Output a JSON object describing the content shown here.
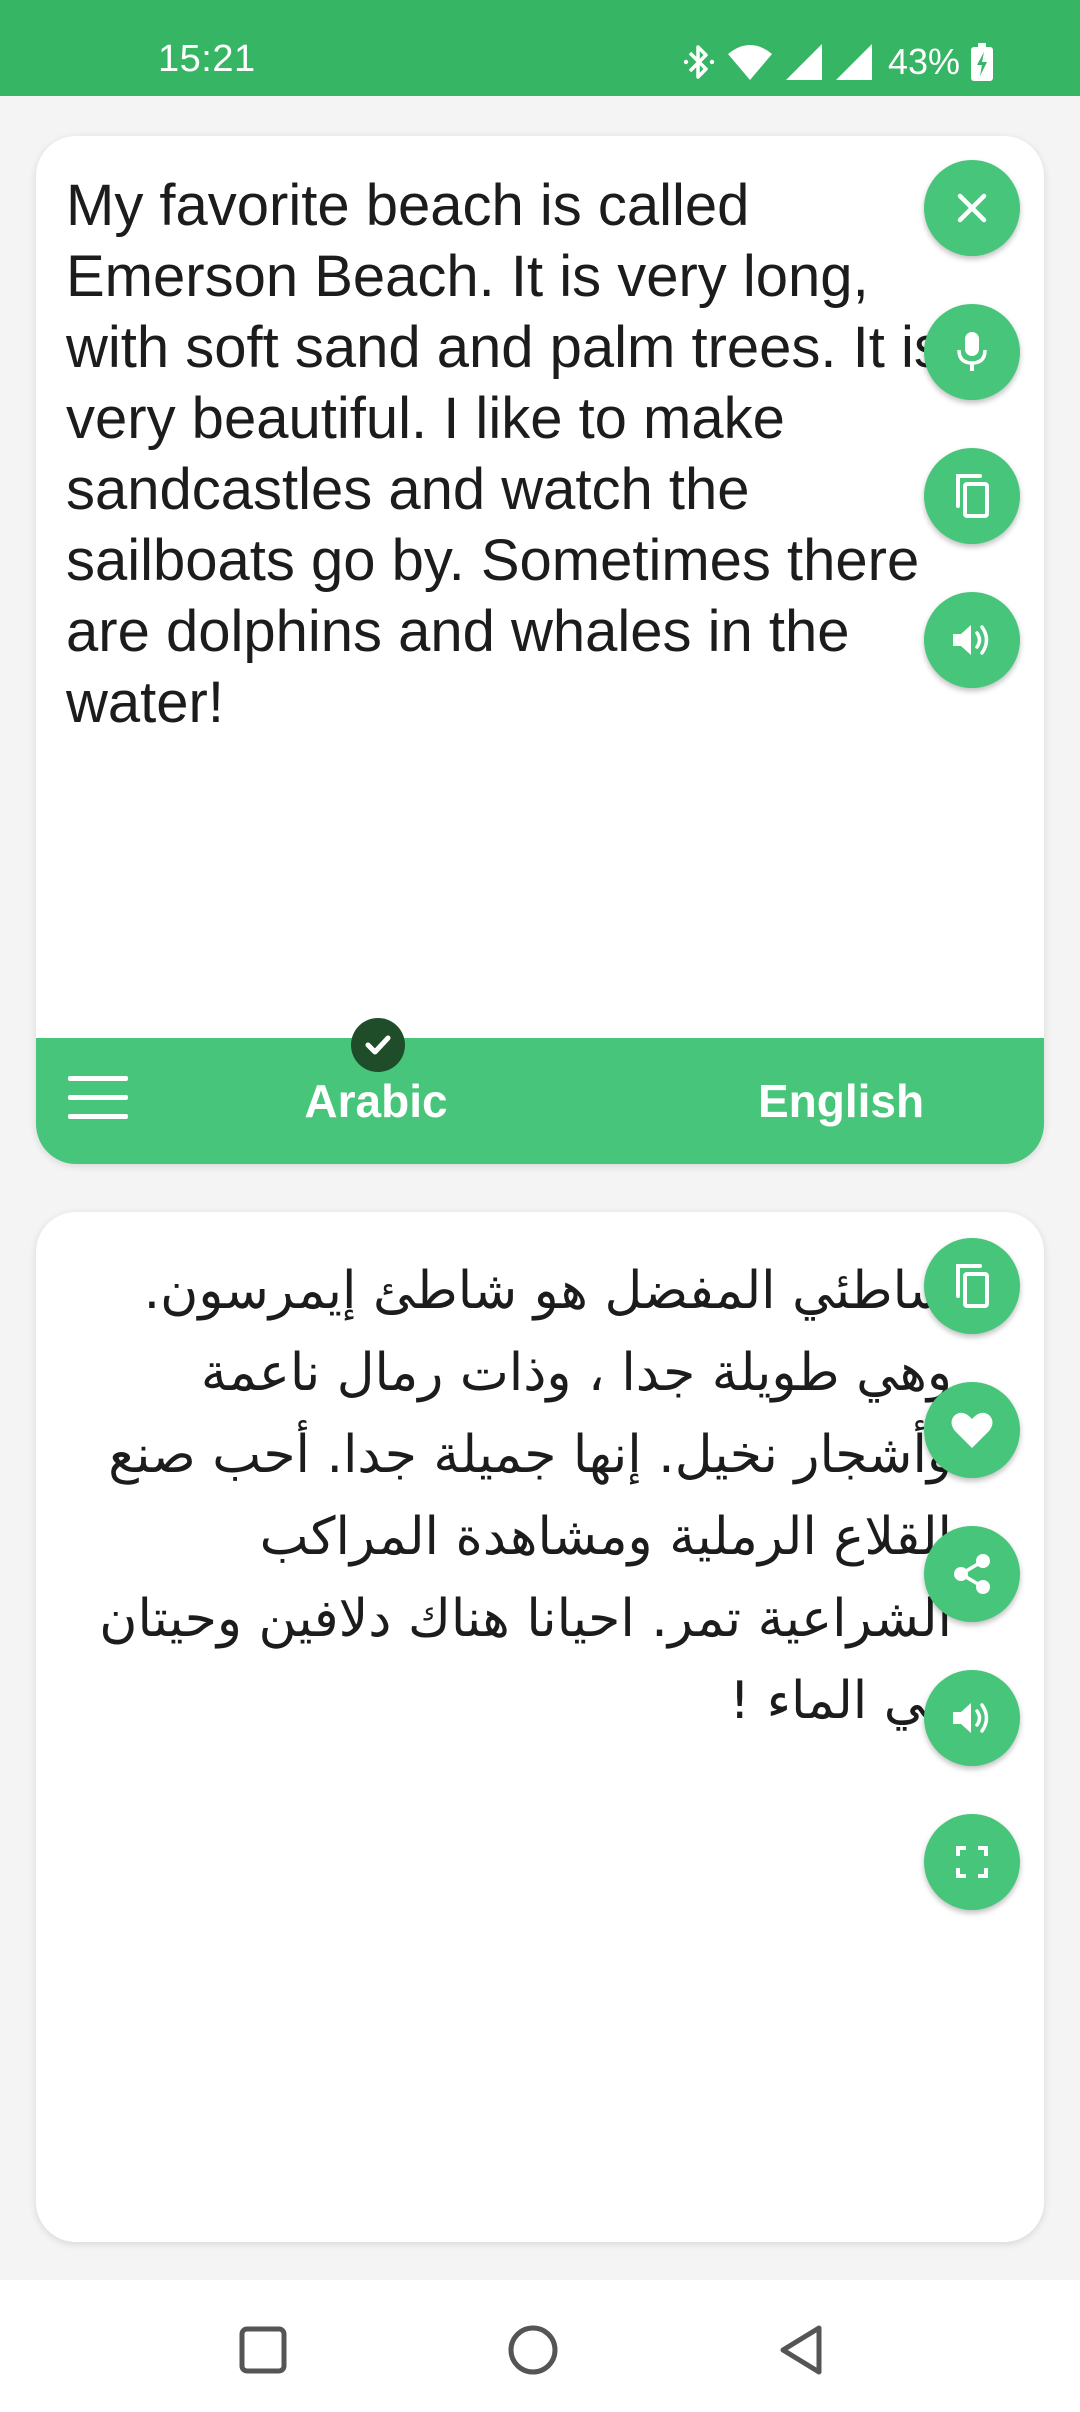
{
  "status_bar": {
    "time": "15:21",
    "battery": "43%",
    "icons": [
      "bluetooth-icon",
      "wifi-icon",
      "signal-icon",
      "signal-icon",
      "battery-charging-icon"
    ]
  },
  "source": {
    "text": "My favorite beach is called Emerson Beach. It is very long, with soft sand and palm trees. It is very beautiful. I like to make sandcastles and watch the sailboats go by. Sometimes there are dolphins and whales in the water!",
    "actions": [
      "close-icon",
      "microphone-icon",
      "copy-icon",
      "speaker-icon"
    ]
  },
  "language_bar": {
    "menu_icon": "menu-icon",
    "source_language": "Arabic",
    "target_language": "English",
    "selected_indicator": "check-icon"
  },
  "translation": {
    "text": "شاطئي المفضل هو شاطئ إيمرسون. وهي طويلة جدا ، وذات رمال ناعمة وأشجار نخيل. إنها جميلة جدا. أحب صنع القلاع الرملية ومشاهدة المراكب الشراعية تمر. احيانا هناك دلافين وحيتان في الماء !",
    "actions": [
      "copy-icon",
      "heart-icon",
      "share-icon",
      "speaker-icon",
      "fullscreen-icon"
    ]
  },
  "navigation": {
    "icons": [
      "recents-icon",
      "home-icon",
      "back-icon"
    ]
  },
  "colors": {
    "status_bar": "#36b565",
    "accent": "#46c57b",
    "check_badge": "#1f4d2a"
  }
}
